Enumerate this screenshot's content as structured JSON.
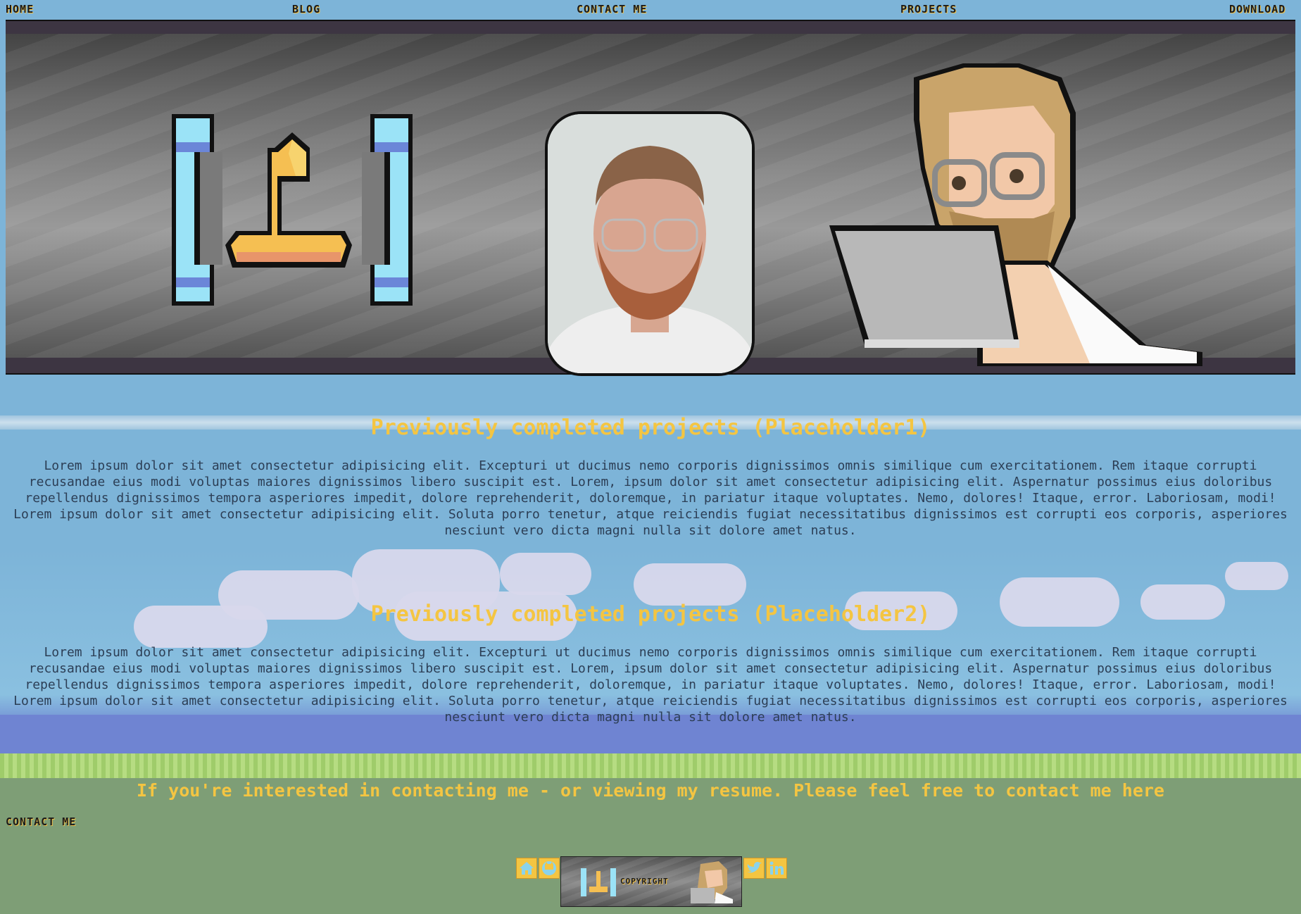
{
  "nav": {
    "home": "HOME",
    "blog": "BLOG",
    "contact": "CONTACT ME",
    "projects": "PROJECTS",
    "download": "DOWNLOAD"
  },
  "sections": [
    {
      "title": "Previously completed projects (Placeholder1)",
      "body": "Lorem ipsum dolor sit amet consectetur adipisicing elit. Excepturi ut ducimus nemo corporis dignissimos omnis similique cum exercitationem. Rem itaque corrupti recusandae eius modi voluptas maiores dignissimos libero suscipit est. Lorem, ipsum dolor sit amet consectetur adipisicing elit. Aspernatur possimus eius doloribus repellendus dignissimos tempora asperiores impedit, dolore reprehenderit, doloremque, in pariatur itaque voluptates. Nemo, dolores! Itaque, error. Laboriosam, modi! Lorem ipsum dolor sit amet consectetur adipisicing elit. Soluta porro tenetur, atque reiciendis fugiat necessitatibus dignissimos est corrupti eos corporis, asperiores nesciunt vero dicta magni nulla sit dolore amet natus."
    },
    {
      "title": "Previously completed projects (Placeholder2)",
      "body": "Lorem ipsum dolor sit amet consectetur adipisicing elit. Excepturi ut ducimus nemo corporis dignissimos omnis similique cum exercitationem. Rem itaque corrupti recusandae eius modi voluptas maiores dignissimos libero suscipit est. Lorem, ipsum dolor sit amet consectetur adipisicing elit. Aspernatur possimus eius doloribus repellendus dignissimos tempora asperiores impedit, dolore reprehenderit, doloremque, in pariatur itaque voluptates. Nemo, dolores! Itaque, error. Laboriosam, modi! Lorem ipsum dolor sit amet consectetur adipisicing elit. Soluta porro tenetur, atque reiciendis fugiat necessitatibus dignissimos est corrupti eos corporis, asperiores nesciunt vero dicta magni nulla sit dolore amet natus."
    }
  ],
  "contact": {
    "line": "If you're interested in contacting me - or viewing my resume. Please feel free to contact me here",
    "link": "CONTACT ME"
  },
  "footer": {
    "banner_text": "COPYRIGHT",
    "icons": [
      "home-icon",
      "github-icon",
      "twitter-icon",
      "linkedin-icon"
    ]
  },
  "colors": {
    "accent": "#f4c542",
    "sky": "#7db4d8",
    "grass": "#7e9e76",
    "text": "#2c3e55"
  }
}
